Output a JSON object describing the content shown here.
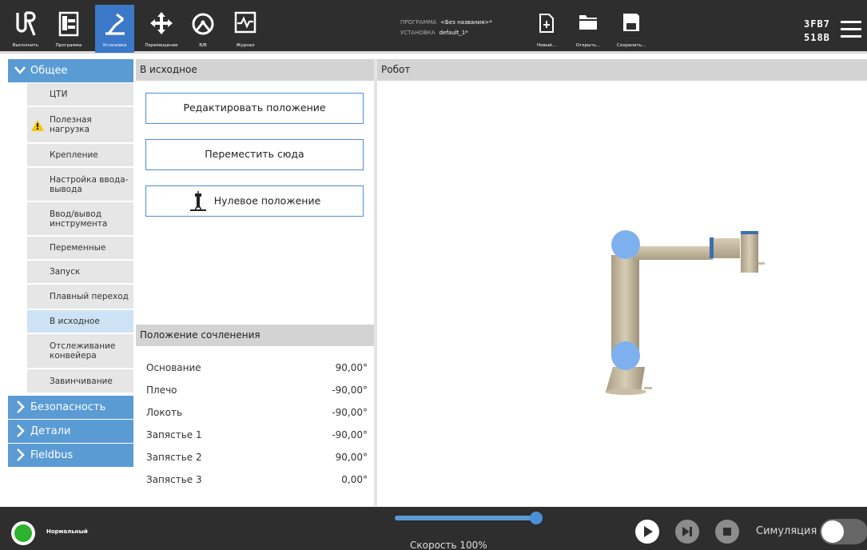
{
  "header": {
    "nav": [
      {
        "label": "Выполнить",
        "icon": "ur-logo-icon"
      },
      {
        "label": "Программа",
        "icon": "program-icon"
      },
      {
        "label": "Установка",
        "icon": "installation-icon"
      },
      {
        "label": "Перемещение",
        "icon": "move-icon"
      },
      {
        "label": "В/В",
        "icon": "io-icon"
      },
      {
        "label": "Журнал",
        "icon": "log-icon"
      }
    ],
    "program_label": "ПРОГРАММА",
    "program_value": "<Без названия>*",
    "installation_label": "УСТАНОВКА",
    "installation_value": "default_1*",
    "file_new": "Новый...",
    "file_open": "Открыть...",
    "file_save": "Сохранить...",
    "serial_line1": "3FB7",
    "serial_line2": "518B"
  },
  "sidebar": {
    "general": "Общее",
    "items": [
      {
        "label": "ЦТИ"
      },
      {
        "label": "Полезная нагрузка",
        "warning": true
      },
      {
        "label": "Крепление"
      },
      {
        "label": "Настройка ввода-вывода"
      },
      {
        "label": "Ввод/вывод инструмента"
      },
      {
        "label": "Переменные"
      },
      {
        "label": "Запуск"
      },
      {
        "label": "Плавный переход"
      },
      {
        "label": "В исходное",
        "selected": true
      },
      {
        "label": "Отслеживание конвейера"
      },
      {
        "label": "Завинчивание"
      }
    ],
    "safety": "Безопасность",
    "details": "Детали",
    "fieldbus": "Fieldbus"
  },
  "home": {
    "title": "В исходное",
    "edit_pose": "Редактировать положение",
    "move_here": "Переместить сюда",
    "zero_position": "Нулевое положение"
  },
  "joints": {
    "title": "Положение сочленения",
    "rows": [
      {
        "name": "Основание",
        "value": "90,00°"
      },
      {
        "name": "Плечо",
        "value": "-90,00°"
      },
      {
        "name": "Локоть",
        "value": "-90,00°"
      },
      {
        "name": "Запястье 1",
        "value": "-90,00°"
      },
      {
        "name": "Запястье 2",
        "value": "90,00°"
      },
      {
        "name": "Запястье 3",
        "value": "0,00°"
      }
    ]
  },
  "robot": {
    "title": "Робот"
  },
  "footer": {
    "status": "Нормальный",
    "status_color": "#2db22d",
    "speed_label": "Скорость 100%",
    "speed_fraction": 1.0,
    "simulation": "Симуляция"
  },
  "colors": {
    "accent": "#5a9bd4",
    "topbar": "#2e2e2e",
    "active_tab": "#3c78c8"
  }
}
